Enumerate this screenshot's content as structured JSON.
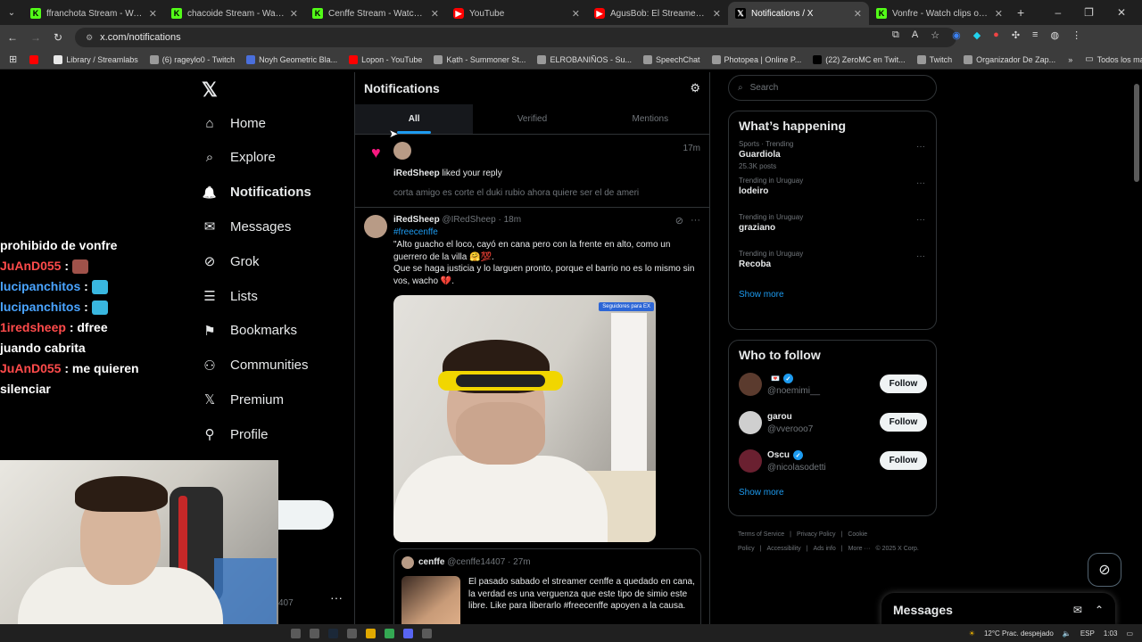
{
  "browser": {
    "tabs": [
      {
        "title": "ffranchota Stream - Watch Live on Kick",
        "icon": "kick",
        "active": false
      },
      {
        "title": "chacoide Stream - Watch Live on Kick",
        "icon": "kick",
        "active": false
      },
      {
        "title": "Cenffe Stream - Watch Live on Kick",
        "icon": "kick",
        "active": false
      },
      {
        "title": "YouTube",
        "icon": "yt",
        "active": false
      },
      {
        "title": "AgusBob: El Streamer que ARRASA",
        "icon": "yt",
        "active": false
      },
      {
        "title": "Notifications / X",
        "icon": "xx",
        "active": true
      },
      {
        "title": "Vonfre - Watch clips on Kick",
        "icon": "kick",
        "active": false
      }
    ],
    "url": "x.com/notifications",
    "bookmarks": [
      {
        "label": "",
        "color": "#ff0000"
      },
      {
        "label": "Library / Streamlabs",
        "color": "#e8e8e8"
      },
      {
        "label": "(6) rageylo0 - Twitch",
        "color": "#9a9a9a"
      },
      {
        "label": "Noyh Geometric Bla...",
        "color": "#4a6fdc"
      },
      {
        "label": "Lopon - YouTube",
        "color": "#ff0000"
      },
      {
        "label": "Kạth - Summoner St...",
        "color": "#9a9a9a"
      },
      {
        "label": "ELROBANIÑOS - Su...",
        "color": "#9a9a9a"
      },
      {
        "label": "SpeechChat",
        "color": "#9a9a9a"
      },
      {
        "label": "Photopea | Online P...",
        "color": "#9a9a9a"
      },
      {
        "label": "(22) ZeroMC en Twit...",
        "color": "#000000"
      },
      {
        "label": "Twitch",
        "color": "#9a9a9a"
      },
      {
        "label": "Organizador De Zap...",
        "color": "#9a9a9a"
      }
    ],
    "all_bookmarks_label": "Todos los marcadores"
  },
  "sidebar": {
    "nav": [
      {
        "label": "Home",
        "icon": "home-icon"
      },
      {
        "label": "Explore",
        "icon": "search-icon"
      },
      {
        "label": "Notifications",
        "icon": "bell-icon"
      },
      {
        "label": "Messages",
        "icon": "mail-icon"
      },
      {
        "label": "Grok",
        "icon": "grok-icon"
      },
      {
        "label": "Lists",
        "icon": "list-icon"
      },
      {
        "label": "Bookmarks",
        "icon": "bookmark-icon"
      },
      {
        "label": "Communities",
        "icon": "people-icon"
      },
      {
        "label": "Premium",
        "icon": "x-icon"
      },
      {
        "label": "Profile",
        "icon": "person-icon"
      }
    ],
    "fragment": "407"
  },
  "stream_chat": {
    "lines": [
      {
        "user": "",
        "text": "prohibido de vonfre"
      },
      {
        "user": "JuAnD055",
        "user_color": "#ff4b4b",
        "text": " :"
      },
      {
        "user": "lucipanchitos",
        "user_color": "#4aa4ff",
        "text": " :"
      },
      {
        "user": "lucipanchitos",
        "user_color": "#4aa4ff",
        "text": " :"
      },
      {
        "user": "1iredsheep",
        "user_color": "#ff4b4b",
        "text": " : dfree"
      },
      {
        "user": "",
        "text": "juando cabrita"
      },
      {
        "user": "JuAnD055",
        "user_color": "#ff4b4b",
        "text": " : me quieren"
      },
      {
        "user": "",
        "text": "silenciar"
      }
    ]
  },
  "main": {
    "title": "Notifications",
    "tabs": [
      "All",
      "Verified",
      "Mentions"
    ],
    "notification": {
      "user": "iRedSheep",
      "action": "liked your reply",
      "time": "17m",
      "quote": "corta amigo es corte el duki rubio ahora quiere ser el de ameri"
    },
    "tweet": {
      "name": "iRedSheep",
      "handle": "@IRedSheep",
      "time": "18m",
      "hashtag": "#freecenffe",
      "body": "\"Alto guacho el loco, cayó en cana pero con la frente en alto, como un guerrero de la villa 🤗💯.\nQue se haga justicia y lo larguen pronto, porque el barrio no es lo mismo sin vos, wacho 💔.",
      "media_badge": "Seguidores para EX",
      "quoted": {
        "name": "cenffe",
        "handle": "@cenffe14407",
        "time": "27m",
        "text": "El pasado sabado el streamer cenffe a quedado en cana, la verdad es una verguenza que este tipo de simio este libre. Like para liberarlo  #freecenffe  apoyen a la causa."
      }
    }
  },
  "right": {
    "search_placeholder": "Search",
    "whats_happening": {
      "title": "What’s happening",
      "trends": [
        {
          "category": "Sports · Trending",
          "name": "Guardiola",
          "count": "25.3K posts"
        },
        {
          "category": "Trending in Uruguay",
          "name": "lodeiro",
          "count": ""
        },
        {
          "category": "Trending in Uruguay",
          "name": "graziano",
          "count": ""
        },
        {
          "category": "Trending in Uruguay",
          "name": "Recoba",
          "count": ""
        }
      ],
      "show_more": "Show more"
    },
    "who_to_follow": {
      "title": "Who to follow",
      "users": [
        {
          "name": "",
          "handle": "@noemimi__",
          "verified": true,
          "avatar_color": "#5b3b2e"
        },
        {
          "name": "garou",
          "handle": "@vverooo7",
          "verified": false,
          "avatar_color": "#cfcfcf"
        },
        {
          "name": "Oscu",
          "handle": "@nicolasodetti",
          "verified": true,
          "avatar_color": "#6a2030"
        }
      ],
      "follow_label": "Follow",
      "show_more": "Show more"
    },
    "footer": [
      "Terms of Service",
      "|",
      "Privacy Policy",
      "|",
      "Cookie Policy",
      "|",
      "Accessibility",
      "|",
      "Ads info",
      "|",
      "More ···",
      "© 2025 X Corp."
    ]
  },
  "messages_drawer": {
    "title": "Messages"
  },
  "taskbar": {
    "weather": "12°C  Prac. despejado",
    "lang": "ESP",
    "time": "1:03"
  }
}
